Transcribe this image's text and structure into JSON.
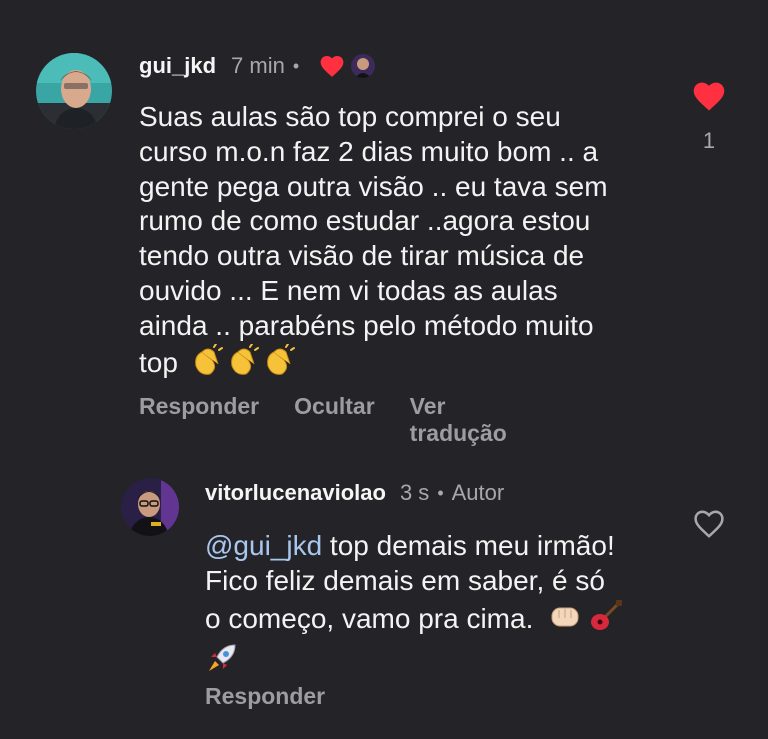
{
  "comment": {
    "username": "gui_jkd",
    "time": "7 min",
    "text_lines": [
      "Suas aulas são top comprei o seu",
      "curso m.o.n faz 2 dias muito bom .. a",
      "gente pega outra visão .. eu tava sem",
      "rumo de como estudar ..agora estou",
      "tendo outra visão de tirar música de",
      "ouvido ... E nem vi todas as aulas",
      "ainda .. parabéns pelo método muito",
      "top"
    ],
    "actions": {
      "reply": "Responder",
      "hide": "Ocultar",
      "translate": "Ver tradução"
    },
    "like_count": "1",
    "colors": {
      "heart": "#ff3040"
    }
  },
  "reply": {
    "username": "vitorlucenaviolao",
    "time": "3 s",
    "badge": "Autor",
    "mention": "@gui_jkd",
    "text_first": " top demais meu irmão!",
    "text_lines": [
      "Fico feliz demais em saber, é só",
      "o começo, vamo pra cima."
    ],
    "actions": {
      "reply": "Responder"
    },
    "colors": {
      "mention": "#a9c6ee"
    }
  },
  "icons": {
    "author_like": "heart-filled-icon",
    "clap": "clapping-hands-icon",
    "fist": "fist-icon",
    "guitar": "guitar-icon",
    "rocket": "rocket-icon",
    "heart_outline": "heart-outline-icon"
  }
}
